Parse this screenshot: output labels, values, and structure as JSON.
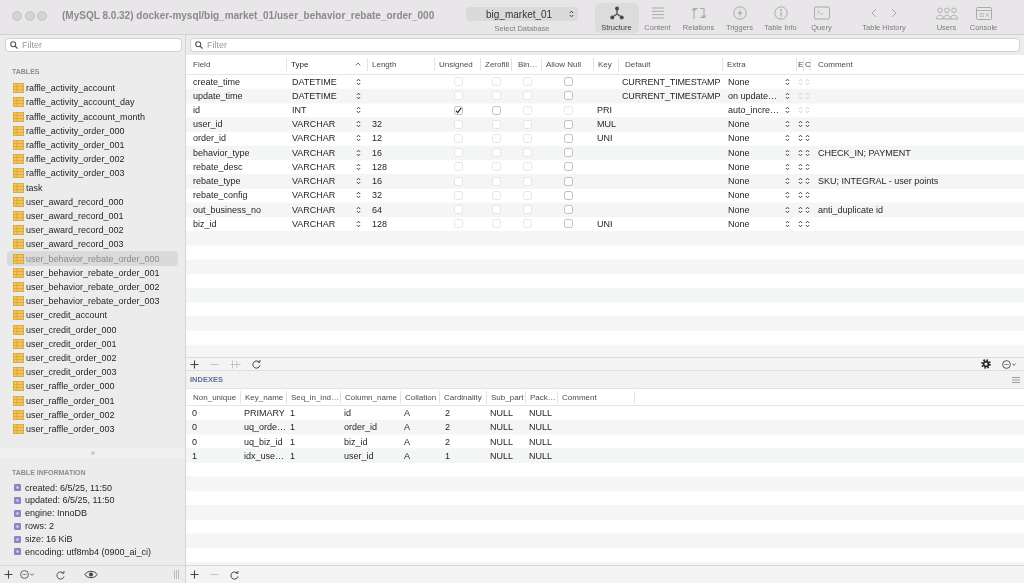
{
  "window": {
    "title": "(MySQL 8.0.32) docker-mysql/big_market_01/user_behavior_rebate_order_000"
  },
  "database_selector": {
    "value": "big_market_01",
    "label": "Select Database"
  },
  "toolbar": {
    "views": [
      {
        "label": "Structure",
        "selected": true
      },
      {
        "label": "Content",
        "selected": false
      },
      {
        "label": "Relations",
        "selected": false
      },
      {
        "label": "Triggers",
        "selected": false
      },
      {
        "label": "Table Info",
        "selected": false
      },
      {
        "label": "Query",
        "selected": false
      }
    ],
    "history": {
      "label": "Table History"
    },
    "tools": [
      {
        "label": "Users"
      },
      {
        "label": "Console"
      }
    ]
  },
  "sidebar": {
    "filter": {
      "placeholder": "Filter"
    },
    "tables_heading": "TABLES",
    "tables": [
      {
        "name": "raffle_activity_account",
        "selected": false
      },
      {
        "name": "raffle_activity_account_day",
        "selected": false
      },
      {
        "name": "raffle_activity_account_month",
        "selected": false
      },
      {
        "name": "raffle_activity_order_000",
        "selected": false
      },
      {
        "name": "raffle_activity_order_001",
        "selected": false
      },
      {
        "name": "raffle_activity_order_002",
        "selected": false
      },
      {
        "name": "raffle_activity_order_003",
        "selected": false
      },
      {
        "name": "task",
        "selected": false
      },
      {
        "name": "user_award_record_000",
        "selected": false
      },
      {
        "name": "user_award_record_001",
        "selected": false
      },
      {
        "name": "user_award_record_002",
        "selected": false
      },
      {
        "name": "user_award_record_003",
        "selected": false
      },
      {
        "name": "user_behavior_rebate_order_000",
        "selected": true
      },
      {
        "name": "user_behavior_rebate_order_001",
        "selected": false
      },
      {
        "name": "user_behavior_rebate_order_002",
        "selected": false
      },
      {
        "name": "user_behavior_rebate_order_003",
        "selected": false
      },
      {
        "name": "user_credit_account",
        "selected": false
      },
      {
        "name": "user_credit_order_000",
        "selected": false
      },
      {
        "name": "user_credit_order_001",
        "selected": false
      },
      {
        "name": "user_credit_order_002",
        "selected": false
      },
      {
        "name": "user_credit_order_003",
        "selected": false
      },
      {
        "name": "user_raffle_order_000",
        "selected": false
      },
      {
        "name": "user_raffle_order_001",
        "selected": false
      },
      {
        "name": "user_raffle_order_002",
        "selected": false
      },
      {
        "name": "user_raffle_order_003",
        "selected": false
      }
    ],
    "info_heading": "TABLE INFORMATION",
    "info": [
      "created: 6/5/25, 11:50",
      "updated: 6/5/25, 11:50",
      "engine: InnoDB",
      "rows: 2",
      "size: 16 KiB",
      "encoding: utf8mb4 (0900_ai_ci)"
    ]
  },
  "structure": {
    "filter": {
      "placeholder": "Filter"
    },
    "columns": [
      {
        "label": "Field",
        "sorted": false
      },
      {
        "label": "Type",
        "sorted": true
      },
      {
        "label": "Length",
        "sorted": false
      },
      {
        "label": "Unsigned",
        "sorted": false
      },
      {
        "label": "Zerofill",
        "sorted": false
      },
      {
        "label": "Bin…",
        "sorted": false
      },
      {
        "label": "Allow Null",
        "sorted": false
      },
      {
        "label": "Key",
        "sorted": false
      },
      {
        "label": "Default",
        "sorted": false
      },
      {
        "label": "Extra",
        "sorted": false
      },
      {
        "label": "E",
        "sorted": false
      },
      {
        "label": "C",
        "sorted": false
      },
      {
        "label": "Comment",
        "sorted": false
      }
    ],
    "rows": [
      {
        "field": "create_time",
        "type": "DATETIME",
        "unsigned": {
          "checked": false,
          "disabled": true
        },
        "zerofill": {
          "checked": false,
          "disabled": true
        },
        "binary": {
          "checked": false,
          "disabled": true
        },
        "allow_null": {
          "checked": false,
          "disabled": false
        },
        "default": "CURRENT_TIMESTAMP",
        "extra": "None",
        "charset_disabled": true
      },
      {
        "field": "update_time",
        "type": "DATETIME",
        "unsigned": {
          "checked": false,
          "disabled": true
        },
        "zerofill": {
          "checked": false,
          "disabled": true
        },
        "binary": {
          "checked": false,
          "disabled": true
        },
        "allow_null": {
          "checked": false,
          "disabled": false
        },
        "default": "CURRENT_TIMESTAMP",
        "extra": "on update…",
        "charset_disabled": true
      },
      {
        "field": "id",
        "type": "INT",
        "unsigned": {
          "checked": true,
          "disabled": false
        },
        "zerofill": {
          "checked": false,
          "disabled": false
        },
        "binary": {
          "checked": false,
          "disabled": true
        },
        "allow_null": {
          "checked": false,
          "disabled": true
        },
        "key": "PRI",
        "extra": "auto_incre…",
        "charset_disabled": true
      },
      {
        "field": "user_id",
        "type": "VARCHAR",
        "length": "32",
        "unsigned": {
          "checked": false,
          "disabled": true
        },
        "zerofill": {
          "checked": false,
          "disabled": true
        },
        "binary": {
          "checked": false,
          "disabled": true
        },
        "allow_null": {
          "checked": false,
          "disabled": false
        },
        "key": "MUL",
        "extra": "None",
        "charset_disabled": false
      },
      {
        "field": "order_id",
        "type": "VARCHAR",
        "length": "12",
        "unsigned": {
          "checked": false,
          "disabled": true
        },
        "zerofill": {
          "checked": false,
          "disabled": true
        },
        "binary": {
          "checked": false,
          "disabled": true
        },
        "allow_null": {
          "checked": false,
          "disabled": false
        },
        "key": "UNI",
        "extra": "None",
        "charset_disabled": false
      },
      {
        "field": "behavior_type",
        "type": "VARCHAR",
        "length": "16",
        "unsigned": {
          "checked": false,
          "disabled": true
        },
        "zerofill": {
          "checked": false,
          "disabled": true
        },
        "binary": {
          "checked": false,
          "disabled": true
        },
        "allow_null": {
          "checked": false,
          "disabled": false
        },
        "extra": "None",
        "charset_disabled": false,
        "comment": "CHECK_IN; PAYMENT"
      },
      {
        "field": "rebate_desc",
        "type": "VARCHAR",
        "length": "128",
        "unsigned": {
          "checked": false,
          "disabled": true
        },
        "zerofill": {
          "checked": false,
          "disabled": true
        },
        "binary": {
          "checked": false,
          "disabled": true
        },
        "allow_null": {
          "checked": false,
          "disabled": false
        },
        "extra": "None",
        "charset_disabled": false
      },
      {
        "field": "rebate_type",
        "type": "VARCHAR",
        "length": "16",
        "unsigned": {
          "checked": false,
          "disabled": true
        },
        "zerofill": {
          "checked": false,
          "disabled": true
        },
        "binary": {
          "checked": false,
          "disabled": true
        },
        "allow_null": {
          "checked": false,
          "disabled": false
        },
        "extra": "None",
        "charset_disabled": false,
        "comment": "SKU; INTEGRAL - user points"
      },
      {
        "field": "rebate_config",
        "type": "VARCHAR",
        "length": "32",
        "unsigned": {
          "checked": false,
          "disabled": true
        },
        "zerofill": {
          "checked": false,
          "disabled": true
        },
        "binary": {
          "checked": false,
          "disabled": true
        },
        "allow_null": {
          "checked": false,
          "disabled": false
        },
        "extra": "None",
        "charset_disabled": false
      },
      {
        "field": "out_business_no",
        "type": "VARCHAR",
        "length": "64",
        "unsigned": {
          "checked": false,
          "disabled": true
        },
        "zerofill": {
          "checked": false,
          "disabled": true
        },
        "binary": {
          "checked": false,
          "disabled": true
        },
        "allow_null": {
          "checked": false,
          "disabled": false
        },
        "extra": "None",
        "charset_disabled": false,
        "comment": "anti_duplicate id"
      },
      {
        "field": "biz_id",
        "type": "VARCHAR",
        "length": "128",
        "unsigned": {
          "checked": false,
          "disabled": true
        },
        "zerofill": {
          "checked": false,
          "disabled": true
        },
        "binary": {
          "checked": false,
          "disabled": true
        },
        "allow_null": {
          "checked": false,
          "disabled": false
        },
        "key": "UNI",
        "extra": "None",
        "charset_disabled": false
      }
    ],
    "actions": [
      {
        "disabled": false
      },
      {
        "disabled": true
      },
      {
        "disabled": true
      },
      {
        "disabled": false
      }
    ]
  },
  "indexes": {
    "heading": "INDEXES",
    "columns": [
      "Non_unique",
      "Key_name",
      "Seq_in_ind…",
      "Column_name",
      "Collation",
      "Cardinality",
      "Sub_part",
      "Pack…",
      "Comment"
    ],
    "rows": [
      [
        "0",
        "PRIMARY",
        "1",
        "id",
        "A",
        "2",
        "NULL",
        "NULL"
      ],
      [
        "0",
        "uq_orde…",
        "1",
        "order_id",
        "A",
        "2",
        "NULL",
        "NULL"
      ],
      [
        "0",
        "uq_biz_id",
        "1",
        "biz_id",
        "A",
        "2",
        "NULL",
        "NULL"
      ],
      [
        "1",
        "idx_use…",
        "1",
        "user_id",
        "A",
        "1",
        "NULL",
        "NULL"
      ]
    ],
    "actions": [
      {
        "disabled": false
      },
      {
        "disabled": true
      },
      {
        "disabled": false
      }
    ]
  }
}
